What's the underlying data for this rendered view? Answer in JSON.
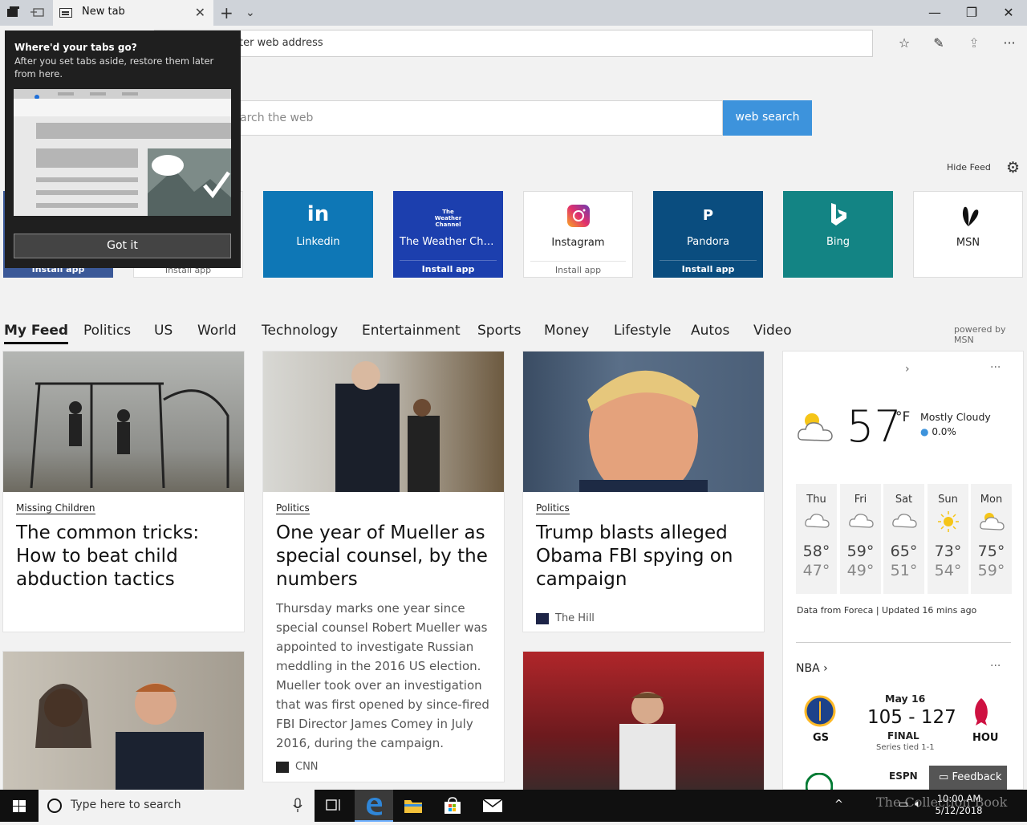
{
  "browser": {
    "tab_title": "New tab",
    "address_placeholder": "Search or enter web address",
    "address_visible": "ter web address"
  },
  "search": {
    "placeholder_visible": "arch the web",
    "button": "web search"
  },
  "feed_controls": {
    "hide_feed": "Hide Feed",
    "powered_by": "powered by MSN"
  },
  "tiles": [
    {
      "name": "Linkedin",
      "logo": "in",
      "install": ""
    },
    {
      "name": "The Weather Cha...",
      "logo": "The Weather Channel",
      "install": "Install app"
    },
    {
      "name": "Instagram",
      "logo": "instagram-icon",
      "install": "Install app"
    },
    {
      "name": "Pandora",
      "logo": "P",
      "install": "Install app"
    },
    {
      "name": "Bing",
      "logo": "bing-icon",
      "install": ""
    },
    {
      "name": "MSN",
      "logo": "msn-icon",
      "install": ""
    }
  ],
  "hidden_tile_labels": [
    "Install app",
    "Install app"
  ],
  "categories": [
    "My Feed",
    "Politics",
    "US",
    "World",
    "Technology",
    "Entertainment",
    "Sports",
    "Money",
    "Lifestyle",
    "Autos",
    "Video"
  ],
  "articles": [
    {
      "category": "Missing Children",
      "headline": "The common tricks: How to beat child abduction tactics"
    },
    {
      "category": "Politics",
      "headline": "One year of Mueller as special counsel, by the numbers",
      "summary": "Thursday marks one year since special counsel Robert Mueller was appointed to investigate Russian meddling in the 2016 US election. Mueller took over an investigation that was first opened by since-fired FBI Director James Comey in July 2016, during the campaign.",
      "source": "CNN"
    },
    {
      "category": "Politics",
      "headline": "Trump blasts alleged Obama FBI spying on campaign",
      "source": "The Hill"
    }
  ],
  "weather": {
    "temp": "57",
    "unit": "°F",
    "condition": "Mostly Cloudy",
    "precip": "0.0%",
    "forecast": [
      {
        "day": "Thu",
        "hi": "58°",
        "lo": "47°",
        "icon": "cloud-icon"
      },
      {
        "day": "Fri",
        "hi": "59°",
        "lo": "49°",
        "icon": "cloud-icon"
      },
      {
        "day": "Sat",
        "hi": "65°",
        "lo": "51°",
        "icon": "cloud-icon"
      },
      {
        "day": "Sun",
        "hi": "73°",
        "lo": "54°",
        "icon": "sun-icon"
      },
      {
        "day": "Mon",
        "hi": "75°",
        "lo": "59°",
        "icon": "partly-sunny-icon"
      }
    ],
    "credit": "Data from Foreca | Updated 16 mins ago"
  },
  "sports": {
    "league": "NBA",
    "date": "May 16",
    "score": "105 - 127",
    "status": "FINAL",
    "series": "Series tied 1-1",
    "home": "GS",
    "away": "HOU",
    "next_network": "ESPN"
  },
  "popup": {
    "title": "Where'd your tabs go?",
    "description": "After you set tabs aside, restore them later from here.",
    "button": "Got it"
  },
  "feedback": "Feedback",
  "taskbar": {
    "search_placeholder": "Type here to search",
    "time": "10:00 AM",
    "date": "5/12/2018"
  },
  "watermark": "The Collection Book"
}
